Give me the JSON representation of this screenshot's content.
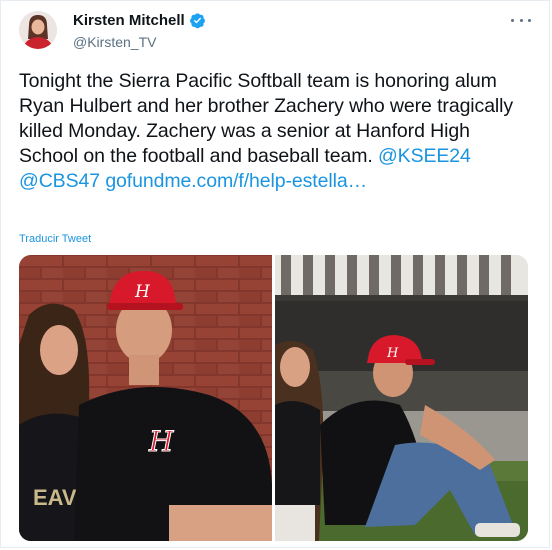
{
  "author": {
    "name": "Kirsten Mitchell",
    "handle": "@Kirsten_TV"
  },
  "tweet": {
    "text_part1": "Tonight the Sierra Pacific Softball team is honoring alum Ryan Hulbert and her brother Zachery who were tragically killed Monday. Zachery was a senior at Hanford High School on the football and baseball team. ",
    "mention1": "@KSEE24",
    "mention2": "@CBS47",
    "link": "gofundme.com/f/help-estella…",
    "translate_label": "Traducir Tweet"
  },
  "media": {
    "photo1_alt": "Photo of two people in front of a brick wall",
    "photo2_alt": "Photo of two people sitting on grass"
  },
  "colors": {
    "link": "#1b95e0",
    "verified": "#1da1f2",
    "cap_red": "#d8192b"
  },
  "icons": [
    "verified-badge-icon",
    "more-options-icon"
  ]
}
